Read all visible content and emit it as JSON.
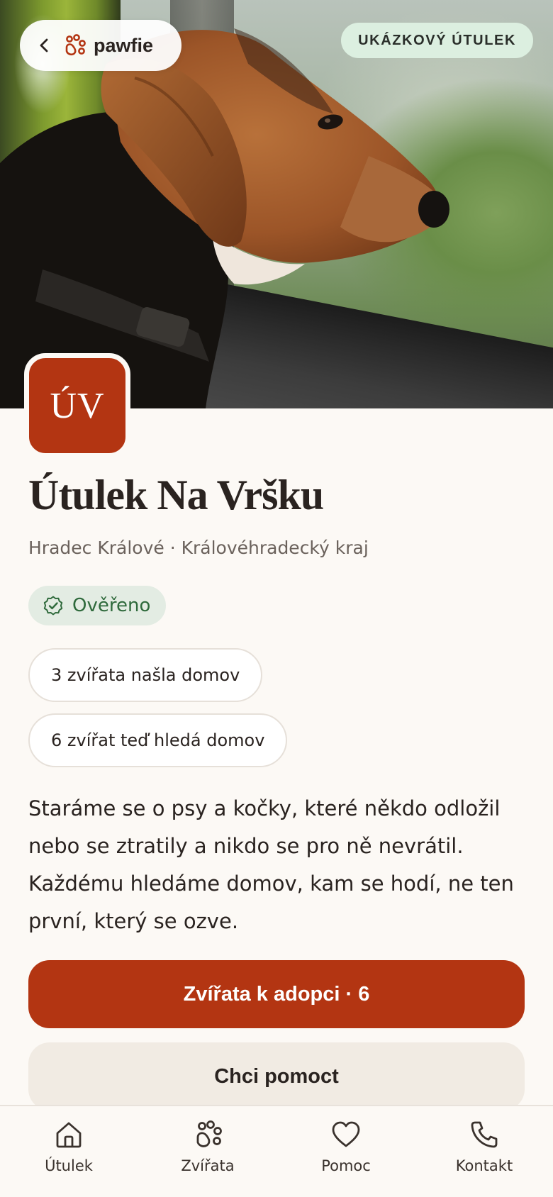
{
  "header": {
    "brand_name": "pawfie",
    "badge": "UKÁZKOVÝ ÚTULEK"
  },
  "shelter": {
    "logo_initials": "ÚV",
    "name": "Útulek Na Vršku",
    "location": "Hradec Králové · Královéhradecký kraj",
    "verified_label": "Ověřeno",
    "stats": [
      "3 zvířata našla domov",
      "6 zvířat teď hledá domov"
    ],
    "description": "Staráme se o psy a kočky, které někdo odložil nebo se ztratily a nikdo se pro ně nevrátil. Každému hledáme domov, kam se hodí, ne ten první, který se ozve."
  },
  "actions": {
    "primary": "Zvířata k adopci · 6",
    "secondary": "Chci pomoct"
  },
  "nav": {
    "items": [
      {
        "label": "Útulek",
        "icon": "home-icon"
      },
      {
        "label": "Zvířata",
        "icon": "paw-icon"
      },
      {
        "label": "Pomoc",
        "icon": "heart-icon"
      },
      {
        "label": "Kontakt",
        "icon": "phone-icon"
      }
    ]
  },
  "colors": {
    "accent": "#b33512",
    "verified_bg": "#e3ece3",
    "verified_text": "#2f6a3c",
    "badge_bg": "#dcefe0",
    "background": "#fcf9f5"
  }
}
